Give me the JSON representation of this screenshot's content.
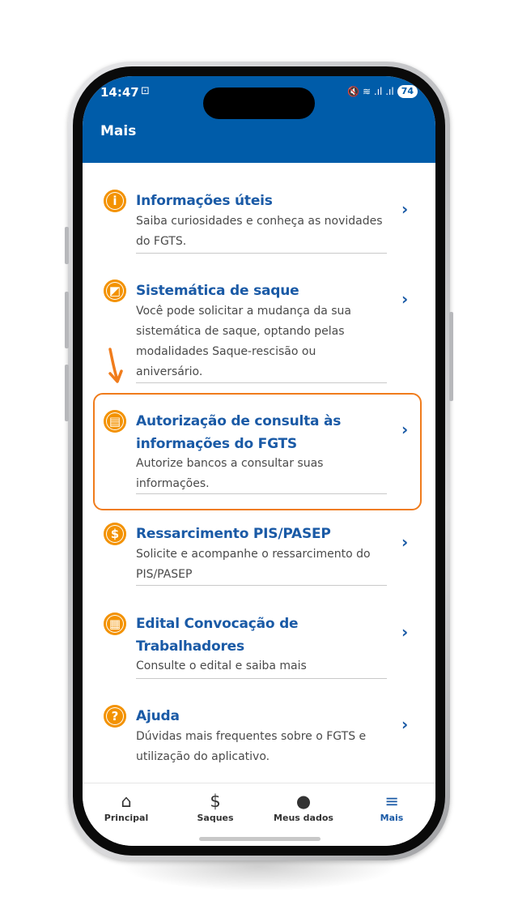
{
  "status_bar": {
    "time": "14:47",
    "screen_record_symbol": "⊡",
    "right_icons": "🔇 ≋ .ıl .ıl",
    "battery": "74"
  },
  "header": {
    "title": "Mais"
  },
  "menu": [
    {
      "icon": "info-icon",
      "glyph": "i",
      "title": "Informações úteis",
      "desc": "Saiba curiosidades e conheça as novidades do FGTS."
    },
    {
      "icon": "withdraw-method-icon",
      "glyph": "◩",
      "title": "Sistemática de saque",
      "desc": "Você pode solicitar a mudança da sua sistemática de saque, optando pelas modalidades Saque-rescisão ou aniversário."
    },
    {
      "icon": "authorization-icon",
      "glyph": "▤",
      "title": "Autorização de consulta às informações do FGTS",
      "desc": "Autorize bancos a consultar suas informações."
    },
    {
      "icon": "reimbursement-icon",
      "glyph": "$",
      "title": "Ressarcimento PIS/PASEP",
      "desc": "Solicite e acompanhe o ressarcimento do PIS/PASEP"
    },
    {
      "icon": "notice-icon",
      "glyph": "▦",
      "title": "Edital Convocação de Trabalhadores",
      "desc": "Consulte o edital e saiba mais"
    },
    {
      "icon": "help-icon",
      "glyph": "?",
      "title": "Ajuda",
      "desc": "Dúvidas mais frequentes sobre o FGTS e utilização do aplicativo."
    }
  ],
  "chevron": "›",
  "bottom_nav": [
    {
      "icon": "home-icon",
      "glyph": "⌂",
      "label": "Principal"
    },
    {
      "icon": "dollar-icon",
      "glyph": "$",
      "label": "Saques"
    },
    {
      "icon": "user-icon",
      "glyph": "●",
      "label": "Meus dados"
    },
    {
      "icon": "menu-icon",
      "glyph": "≡",
      "label": "Mais",
      "active": true
    }
  ],
  "colors": {
    "brand_blue": "#005ca9",
    "title_blue": "#1a5aa6",
    "icon_orange": "#f39200",
    "highlight_orange": "#f07c1c"
  }
}
